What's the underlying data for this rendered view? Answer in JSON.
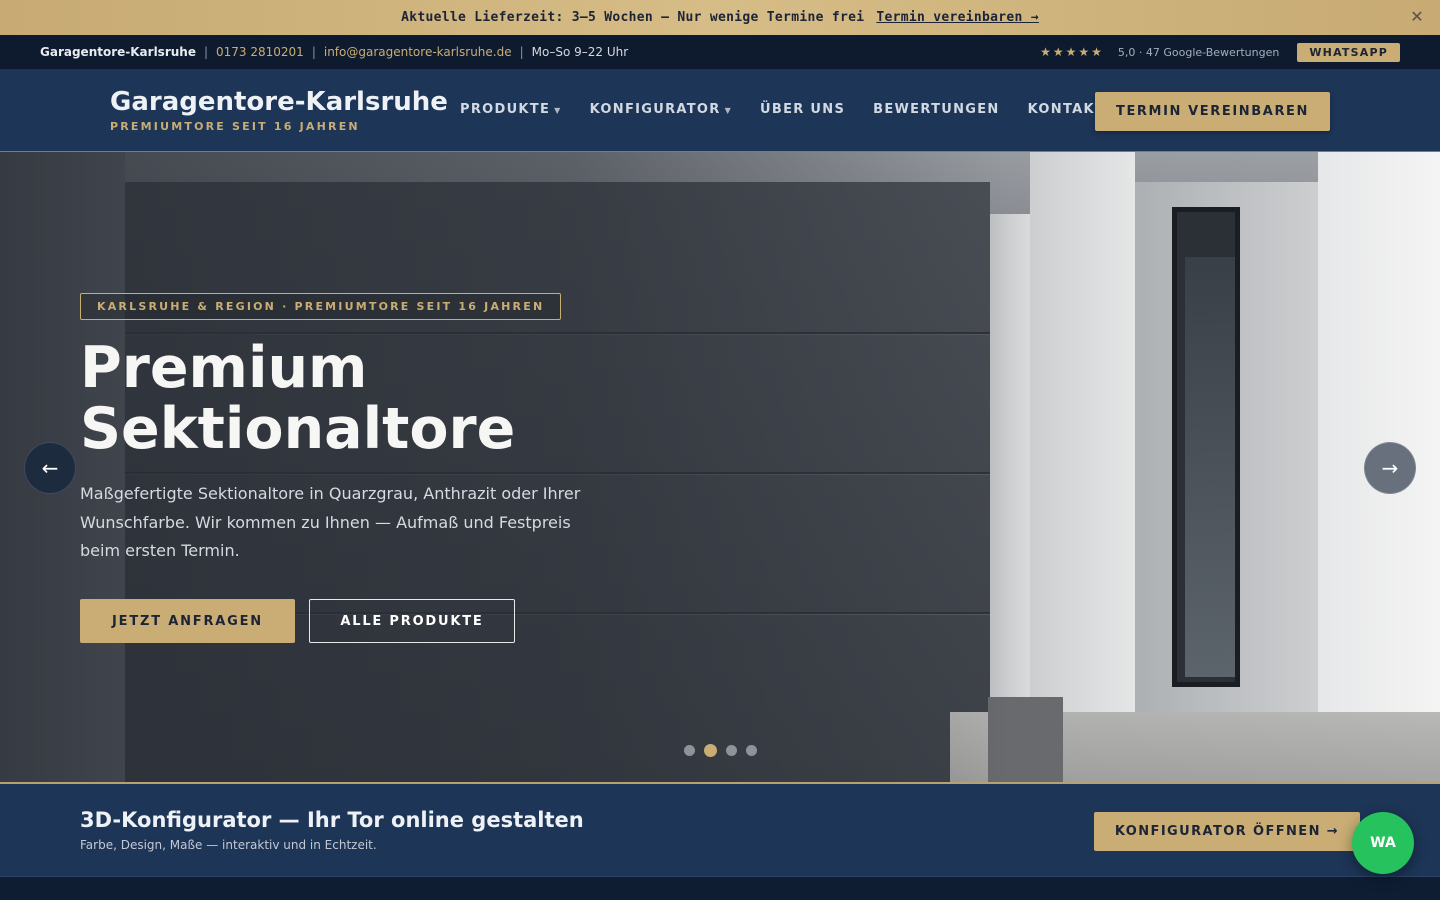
{
  "announce": {
    "text": "Aktuelle Lieferzeit: 3–5 Wochen — Nur wenige Termine frei",
    "link": "Termin vereinbaren →",
    "close": "✕"
  },
  "contact": {
    "brand": "Garagentore-Karlsruhe",
    "phone": "0173 2810201",
    "email": "info@garagentore-karlsruhe.de",
    "hours": "Mo–So 9–22 Uhr",
    "separator": "|",
    "stars": "★★★★★",
    "rating": "5,0 · 47 Google-Bewertungen",
    "whatsapp": "WHATSAPP"
  },
  "nav": {
    "logo_title": "Garagentore-Karlsruhe",
    "logo_sub": "PREMIUMTORE SEIT 16 JAHREN",
    "items": [
      {
        "label": "PRODUKTE",
        "caret": "▼"
      },
      {
        "label": "KONFIGURATOR",
        "caret": "▼"
      },
      {
        "label": "ÜBER UNS"
      },
      {
        "label": "BEWERTUNGEN"
      },
      {
        "label": "KONTAKT"
      }
    ],
    "cta": "TERMIN VEREINBAREN"
  },
  "hero": {
    "badge": "KARLSRUHE & REGION · PREMIUMTORE SEIT 16 JAHREN",
    "title_line1": "Premium",
    "title_line2": "Sektionaltore",
    "description": "Maßgefertigte Sektionaltore in Quarzgrau, Anthrazit oder Ihrer Wunschfarbe. Wir kommen zu Ihnen — Aufmaß und Festpreis beim ersten Termin.",
    "primary_btn": "JETZT ANFRAGEN",
    "secondary_btn": "ALLE PRODUKTE",
    "prev_arrow": "←",
    "next_arrow": "→",
    "slides_total": 4,
    "active_slide": 2
  },
  "config": {
    "title": "3D-Konfigurator — Ihr Tor online gestalten",
    "subtitle": "Farbe, Design, Maße — interaktiv und in Echtzeit.",
    "button": "KONFIGURATOR ÖFFNEN →"
  },
  "whatsapp_float": "WA",
  "colors": {
    "gold": "#c9ad74",
    "navy": "#1d3557",
    "dark_navy": "#0e1b2f",
    "whatsapp_green": "#25c25e"
  }
}
